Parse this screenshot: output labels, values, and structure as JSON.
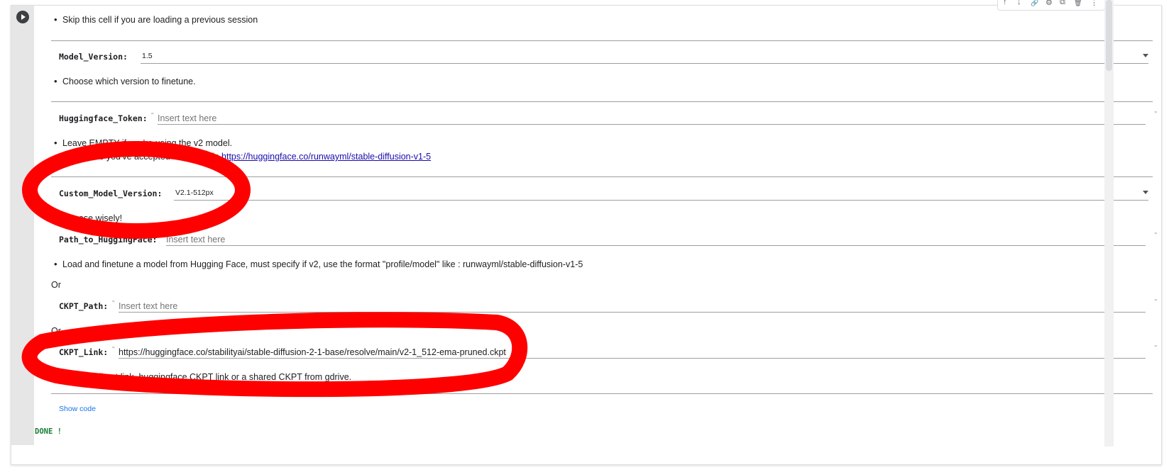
{
  "params": {
    "skip_note": "Skip this cell if you are loading a previous session",
    "model_version": {
      "label": "Model_Version:",
      "value": "1.5",
      "note": "Choose which version to finetune."
    },
    "hf_token": {
      "label": "Huggingface_Token:",
      "placeholder": "Insert text here",
      "note1": "Leave EMPTY if you're using the v2 model.",
      "note2_prefix": "Make sure you've accepted the terms in ",
      "note2_link": "https://huggingface.co/runwayml/stable-diffusion-v1-5"
    },
    "custom_model_version": {
      "label": "Custom_Model_Version:",
      "value": "V2.1-512px",
      "note": "Choose wisely!"
    },
    "path_to_hf": {
      "label": "Path_to_HuggingFace:",
      "placeholder": "Insert text here",
      "note": "Load and finetune a model from Hugging Face, must specify if v2, use the format \"profile/model\" like : runwayml/stable-diffusion-v1-5"
    },
    "or1": "Or",
    "ckpt_path": {
      "label": "CKPT_Path:",
      "placeholder": "Insert text here"
    },
    "or2": "Or",
    "ckpt_link": {
      "label": "CKPT_Link:",
      "value": "https://huggingface.co/stabilityai/stable-diffusion-2-1-base/resolve/main/v2-1_512-ema-pruned.ckpt",
      "note": "A CKPT direct link, huggingface CKPT link or a shared CKPT from gdrive."
    }
  },
  "quote_mark": "\"",
  "show_code": "Show code",
  "output": "DONE !",
  "toolbar": {
    "up": "↑",
    "down": "↓",
    "link": "🔗",
    "settings": "⚙",
    "mirror": "⧉",
    "delete": "🗑",
    "more": "⋮"
  },
  "icons": {
    "run": "play-icon",
    "up": "arrow-up-icon",
    "down": "arrow-down-icon",
    "link": "link-icon",
    "settings": "gear-icon",
    "mirror": "mirror-cell-icon",
    "delete": "trash-icon",
    "more": "more-vert-icon"
  },
  "colors": {
    "annotation": "#ff0000",
    "link": "#1a0dab",
    "show_code": "#1a73e8",
    "output": "#188038"
  }
}
